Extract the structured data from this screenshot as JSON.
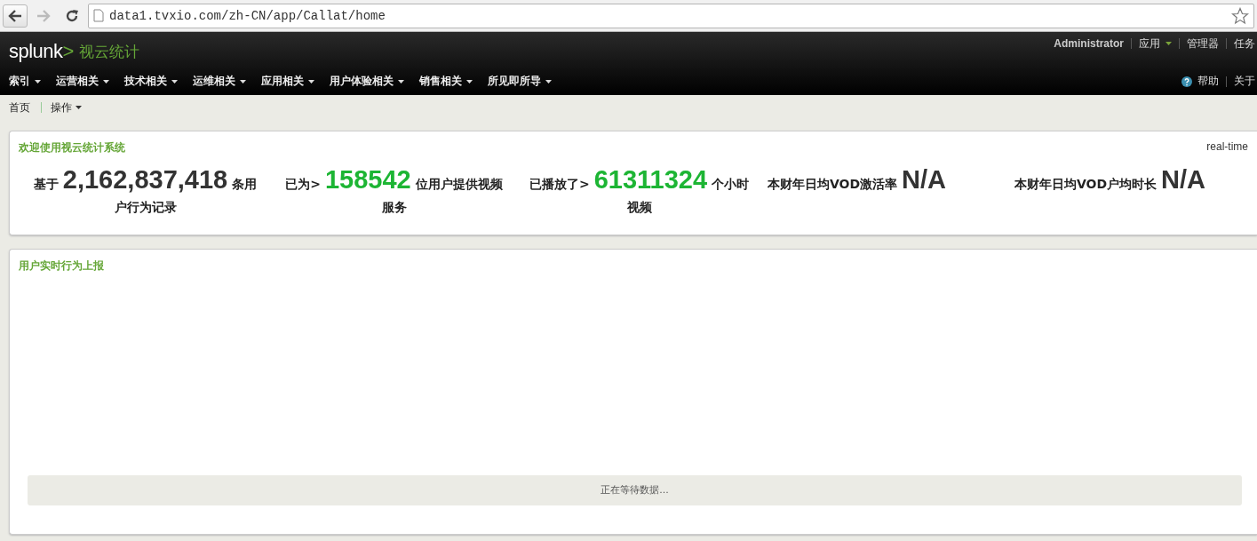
{
  "browser": {
    "url": "data1.tvxio.com/zh-CN/app/Callat/home"
  },
  "header": {
    "logo": {
      "word": "splunk",
      "mark": ">"
    },
    "app_name": "视云统计",
    "user_links": [
      {
        "label": "Administrator",
        "kind": "user"
      },
      {
        "label": "应用",
        "kind": "menu"
      },
      {
        "label": "管理器",
        "kind": "link"
      },
      {
        "label": "任务",
        "kind": "link"
      }
    ],
    "help_links": [
      {
        "label": "帮助",
        "kind": "help"
      },
      {
        "label": "关于",
        "kind": "link"
      }
    ],
    "nav": [
      "索引",
      "运营相关",
      "技术相关",
      "运维相关",
      "应用相关",
      "用户体验相关",
      "销售相关",
      "所见即所导"
    ]
  },
  "breadcrumb": [
    {
      "label": "首页",
      "kind": "link"
    },
    {
      "label": "操作",
      "kind": "menu"
    }
  ],
  "welcome_panel": {
    "title": "欢迎使用视云统计系统",
    "badge": "real-time",
    "stats": [
      {
        "prefix": "基于",
        "value": "2,162,837,418",
        "suffix": "条用",
        "suffix_line2": "户行为记录",
        "color": "#333333"
      },
      {
        "prefix": "已为>",
        "value": "158542",
        "suffix": "位用户提供视频",
        "suffix_line2": "服务",
        "color": "#1db534"
      },
      {
        "prefix": "已播放了>",
        "value": "61311324",
        "suffix": "个小时",
        "suffix_line2": "视频",
        "color": "#1db534"
      },
      {
        "prefix": "本财年日均VOD激活率",
        "value": "N/A",
        "color": "#333333"
      },
      {
        "prefix": "本财年日均VOD户均时长",
        "value": "N/A",
        "color": "#333333"
      }
    ]
  },
  "report_panel": {
    "title": "用户实时行为上报",
    "status": "正在等待数据..."
  }
}
